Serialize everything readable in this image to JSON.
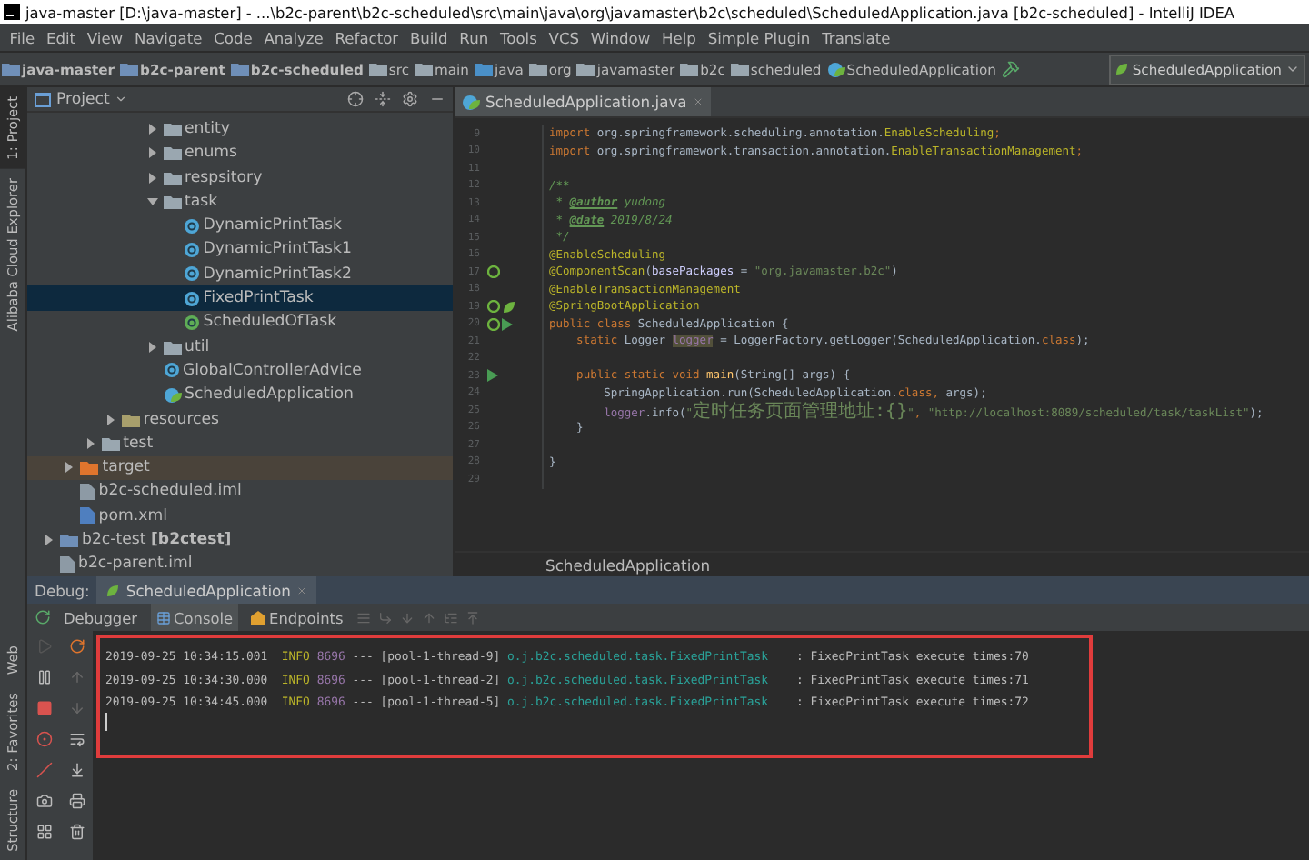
{
  "window": {
    "title": "java-master [D:\\java-master] - ...\\b2c-parent\\b2c-scheduled\\src\\main\\java\\org\\javamaster\\b2c\\scheduled\\ScheduledApplication.java [b2c-scheduled] - IntelliJ IDEA"
  },
  "menu": [
    "File",
    "Edit",
    "View",
    "Navigate",
    "Code",
    "Analyze",
    "Refactor",
    "Build",
    "Run",
    "Tools",
    "VCS",
    "Window",
    "Help",
    "Simple Plugin",
    "Translate"
  ],
  "navbar": {
    "crumbs": [
      {
        "label": "java-master",
        "kind": "module"
      },
      {
        "label": "b2c-parent",
        "kind": "module"
      },
      {
        "label": "b2c-scheduled",
        "kind": "module"
      },
      {
        "label": "src",
        "kind": "folder"
      },
      {
        "label": "main",
        "kind": "folder"
      },
      {
        "label": "java",
        "kind": "source"
      },
      {
        "label": "org",
        "kind": "folder"
      },
      {
        "label": "javamaster",
        "kind": "folder"
      },
      {
        "label": "b2c",
        "kind": "folder"
      },
      {
        "label": "scheduled",
        "kind": "folder"
      },
      {
        "label": "ScheduledApplication",
        "kind": "spring-class"
      }
    ],
    "run_config": "ScheduledApplication"
  },
  "left_stripe": {
    "top": [
      {
        "label": "1: Project",
        "selected": true
      },
      {
        "label": "Alibaba Cloud Explorer",
        "selected": false
      }
    ],
    "bottom": [
      {
        "label": "Web",
        "selected": false
      },
      {
        "label": "2: Favorites",
        "selected": false
      },
      {
        "label": "Structure",
        "selected": false
      }
    ]
  },
  "project": {
    "title": "Project",
    "tree": [
      {
        "children": [
          {
            "children": [
              {
                "children": [
                  {
                    "children": [
                      {
                        "children": [
                          {
                            "label": "entity",
                            "kind": "package",
                            "expanded": false,
                            "selected": false
                          },
                          {
                            "label": "enums",
                            "kind": "package",
                            "expanded": false,
                            "selected": false
                          },
                          {
                            "label": "respsitory",
                            "kind": "package",
                            "expanded": false,
                            "selected": false
                          },
                          {
                            "label": "task",
                            "kind": "package",
                            "expanded": true,
                            "selected": false,
                            "children": [
                              {
                                "label": "DynamicPrintTask",
                                "kind": "class",
                                "selected": false
                              },
                              {
                                "label": "DynamicPrintTask1",
                                "kind": "class",
                                "selected": false
                              },
                              {
                                "label": "DynamicPrintTask2",
                                "kind": "class",
                                "selected": false
                              },
                              {
                                "label": "FixedPrintTask",
                                "kind": "class",
                                "selected": true
                              },
                              {
                                "label": "ScheduledOfTask",
                                "kind": "interface",
                                "selected": false
                              }
                            ]
                          },
                          {
                            "label": "util",
                            "kind": "package",
                            "expanded": false,
                            "selected": false
                          },
                          {
                            "label": "GlobalControllerAdvice",
                            "kind": "class",
                            "selected": false
                          },
                          {
                            "label": "ScheduledApplication",
                            "kind": "spring-class",
                            "selected": false
                          }
                        ]
                      }
                    ]
                  },
                  {
                    "label": "resources",
                    "kind": "resources",
                    "expanded": false,
                    "selected": false
                  }
                ]
              },
              {
                "label": "test",
                "kind": "folder",
                "expanded": false,
                "selected": false
              }
            ]
          },
          {
            "label": "target",
            "kind": "excluded",
            "expanded": false,
            "selected": false
          },
          {
            "label": "b2c-scheduled.iml",
            "kind": "iml",
            "selected": false
          },
          {
            "label": "pom.xml",
            "kind": "pom",
            "selected": false
          }
        ]
      },
      {
        "label": "b2c-test **[b2ctest]**",
        "kind": "module",
        "expanded": false,
        "selected": false
      },
      {
        "label": "b2c-parent.iml",
        "kind": "iml",
        "selected": false
      }
    ]
  },
  "editor": {
    "tabs": [
      {
        "label": "ScheduledApplication.java",
        "selected": true
      }
    ],
    "lines": [
      {
        "number": "9",
        "segments": [
          {
            "text": "import",
            "kind": "kw"
          },
          {
            "text": " org.springframework.scheduling.annotation.",
            "kind": "plain"
          },
          {
            "text": "EnableScheduling",
            "kind": "ann"
          },
          {
            "text": ";",
            "kind": "kw"
          }
        ]
      },
      {
        "number": "10",
        "segments": [
          {
            "text": "import",
            "kind": "kw"
          },
          {
            "text": " org.springframework.transaction.annotation.",
            "kind": "plain"
          },
          {
            "text": "EnableTransactionManagement",
            "kind": "ann"
          },
          {
            "text": ";",
            "kind": "kw"
          }
        ]
      },
      {
        "number": "11"
      },
      {
        "number": "12",
        "segments": [
          {
            "text": "/**",
            "kind": "doc"
          }
        ]
      },
      {
        "number": "13",
        "segments": [
          {
            "text": " * ",
            "kind": "doc"
          },
          {
            "text": "@author",
            "kind": "doctag"
          },
          {
            "text": " yudong",
            "kind": "doc"
          }
        ]
      },
      {
        "number": "14",
        "segments": [
          {
            "text": " * ",
            "kind": "doc"
          },
          {
            "text": "@date",
            "kind": "doctag"
          },
          {
            "text": " 2019/8/24",
            "kind": "doc"
          }
        ]
      },
      {
        "number": "15",
        "segments": [
          {
            "text": " */",
            "kind": "doc"
          }
        ]
      },
      {
        "number": "16",
        "segments": [
          {
            "text": "@EnableScheduling",
            "kind": "ann"
          }
        ]
      },
      {
        "number": "17",
        "gutter": [
          {
            "kind": "bean"
          }
        ],
        "segments": [
          {
            "text": "@ComponentScan",
            "kind": "ann"
          },
          {
            "text": "(",
            "kind": "plain"
          },
          {
            "text": "basePackages",
            "kind": "param"
          },
          {
            "text": " = ",
            "kind": "plain"
          },
          {
            "text": "\"org.javamaster.b2c\"",
            "kind": "str"
          },
          {
            "text": ")",
            "kind": "plain"
          }
        ]
      },
      {
        "number": "18",
        "segments": [
          {
            "text": "@EnableTransactionManagement",
            "kind": "ann"
          }
        ]
      },
      {
        "number": "19",
        "gutter": [
          {
            "kind": "bean"
          },
          {
            "kind": "leaf"
          }
        ],
        "segments": [
          {
            "text": "@SpringBootApplication",
            "kind": "ann"
          }
        ]
      },
      {
        "number": "20",
        "gutter": [
          {
            "kind": "bean"
          },
          {
            "kind": "run"
          }
        ],
        "segments": [
          {
            "text": "public class ",
            "kind": "kw"
          },
          {
            "text": "ScheduledApplication {",
            "kind": "plain"
          }
        ]
      },
      {
        "number": "21",
        "segments": [
          {
            "text": "    static ",
            "kind": "kw"
          },
          {
            "text": "Logger ",
            "kind": "plain"
          },
          {
            "text": "logger",
            "kind": "field-hl"
          },
          {
            "text": " = LoggerFactory.getLogger(ScheduledApplication.",
            "kind": "plain"
          },
          {
            "text": "class",
            "kind": "kw"
          },
          {
            "text": ");",
            "kind": "plain"
          }
        ]
      },
      {
        "number": "22"
      },
      {
        "number": "23",
        "gutter": [
          {
            "kind": "run"
          }
        ],
        "segments": [
          {
            "text": "    public static void ",
            "kind": "kw"
          },
          {
            "text": "main",
            "kind": "method"
          },
          {
            "text": "(String[] args) {",
            "kind": "plain"
          }
        ]
      },
      {
        "number": "24",
        "segments": [
          {
            "text": "        SpringApplication.run(ScheduledApplication.",
            "kind": "plain"
          },
          {
            "text": "class, ",
            "kind": "kw"
          },
          {
            "text": "args);",
            "kind": "plain"
          }
        ]
      },
      {
        "number": "25",
        "segments": [
          {
            "text": "        logger",
            "kind": "field"
          },
          {
            "text": ".info(",
            "kind": "plain"
          },
          {
            "text": "\"",
            "kind": "str"
          },
          {
            "text": "定时任务页面管理地址:{}",
            "kind": "str-cjk"
          },
          {
            "text": "\"",
            "kind": "str"
          },
          {
            "text": ", ",
            "kind": "kw"
          },
          {
            "text": "\"http://localhost:8089/scheduled/task/taskList\"",
            "kind": "str"
          },
          {
            "text": ");",
            "kind": "plain"
          }
        ]
      },
      {
        "number": "26",
        "segments": [
          {
            "text": "    }",
            "kind": "plain"
          }
        ]
      },
      {
        "number": "27"
      },
      {
        "number": "28",
        "segments": [
          {
            "text": "}",
            "kind": "plain"
          }
        ]
      },
      {
        "number": "29"
      }
    ],
    "breadcrumb": "ScheduledApplication"
  },
  "debug": {
    "label": "Debug:",
    "tabs": [
      {
        "label": "ScheduledApplication",
        "selected": true
      }
    ],
    "toolbar_tabs": [
      {
        "label": "Debugger",
        "selected": false,
        "kind": "plain"
      },
      {
        "label": "Console",
        "selected": true,
        "kind": "console"
      },
      {
        "label": "Endpoints",
        "selected": false,
        "kind": "endpoints"
      }
    ],
    "highlight": true,
    "console": [
      {
        "time": "2019-09-25 10:34:15.001",
        "level": "INFO",
        "pid": "8696",
        "sep": "---",
        "thread": "[pool-1-thread-9]",
        "logger": "o.j.b2c.scheduled.task.FixedPrintTask",
        "message": ": FixedPrintTask execute times:70"
      },
      {
        "time": "2019-09-25 10:34:30.000",
        "level": "INFO",
        "pid": "8696",
        "sep": "---",
        "thread": "[pool-1-thread-2]",
        "logger": "o.j.b2c.scheduled.task.FixedPrintTask",
        "message": ": FixedPrintTask execute times:71"
      },
      {
        "time": "2019-09-25 10:34:45.000",
        "level": "INFO",
        "pid": "8696",
        "sep": "---",
        "thread": "[pool-1-thread-5]",
        "logger": "o.j.b2c.scheduled.task.FixedPrintTask",
        "message": ": FixedPrintTask execute times:72"
      }
    ]
  }
}
